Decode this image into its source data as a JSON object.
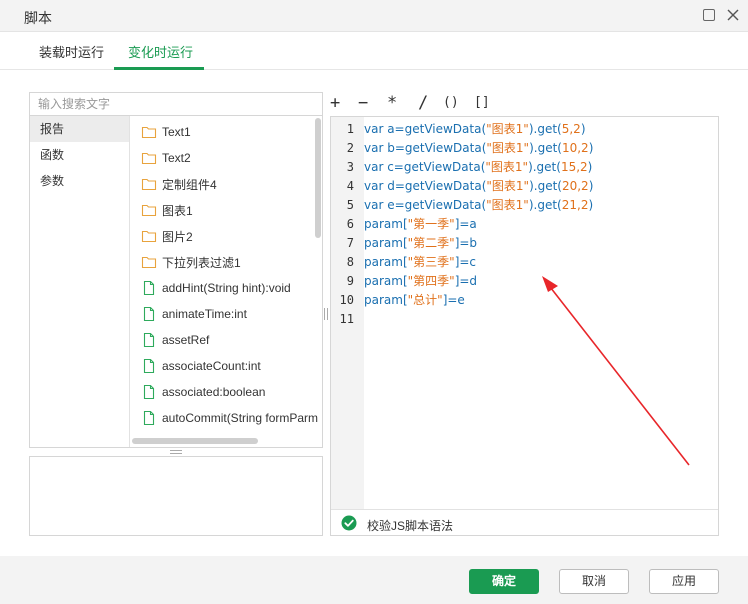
{
  "window": {
    "title": "脚本"
  },
  "tabs": [
    {
      "label": "装载时运行",
      "active": false
    },
    {
      "label": "变化时运行",
      "active": true
    }
  ],
  "search": {
    "placeholder": "输入搜索文字"
  },
  "categories": [
    {
      "label": "报告",
      "selected": true
    },
    {
      "label": "函数",
      "selected": false
    },
    {
      "label": "参数",
      "selected": false
    }
  ],
  "items": [
    {
      "label": "Text1",
      "icon": "folder-icon"
    },
    {
      "label": "Text2",
      "icon": "folder-icon"
    },
    {
      "label": "定制组件4",
      "icon": "folder-icon"
    },
    {
      "label": "图表1",
      "icon": "folder-icon"
    },
    {
      "label": "图片2",
      "icon": "folder-icon"
    },
    {
      "label": "下拉列表过滤1",
      "icon": "folder-icon"
    },
    {
      "label": "addHint(String hint):void",
      "icon": "file-icon"
    },
    {
      "label": "animateTime:int",
      "icon": "file-icon"
    },
    {
      "label": "assetRef",
      "icon": "file-icon"
    },
    {
      "label": "associateCount:int",
      "icon": "file-icon"
    },
    {
      "label": "associated:boolean",
      "icon": "file-icon"
    },
    {
      "label": "autoCommit(String formParm",
      "icon": "file-icon"
    }
  ],
  "operators": [
    "+",
    "−",
    "*",
    "/",
    "()",
    "[]"
  ],
  "code": {
    "line_numbers": [
      "1",
      "2",
      "3",
      "4",
      "5",
      "6",
      "7",
      "8",
      "9",
      "10",
      "11"
    ],
    "lines": [
      {
        "pre": "var a=getViewData(",
        "str": "\"图表1\"",
        "mid": ").get(",
        "num": "5,2",
        "post": ")"
      },
      {
        "pre": "var b=getViewData(",
        "str": "\"图表1\"",
        "mid": ").get(",
        "num": "10,2",
        "post": ")"
      },
      {
        "pre": "var c=getViewData(",
        "str": "\"图表1\"",
        "mid": ").get(",
        "num": "15,2",
        "post": ")"
      },
      {
        "pre": "var d=getViewData(",
        "str": "\"图表1\"",
        "mid": ").get(",
        "num": "20,2",
        "post": ")"
      },
      {
        "pre": "var e=getViewData(",
        "str": "\"图表1\"",
        "mid": ").get(",
        "num": "21,2",
        "post": ")"
      },
      {
        "pre": "param[",
        "str": "\"第一季\"",
        "mid": "]=a",
        "num": "",
        "post": ""
      },
      {
        "pre": "param[",
        "str": "\"第二季\"",
        "mid": "]=b",
        "num": "",
        "post": ""
      },
      {
        "pre": "param[",
        "str": "\"第三季\"",
        "mid": "]=c",
        "num": "",
        "post": ""
      },
      {
        "pre": "param[",
        "str": "\"第四季\"",
        "mid": "]=d",
        "num": "",
        "post": ""
      },
      {
        "pre": "param[",
        "str": "\"总计\"",
        "mid": "]=e",
        "num": "",
        "post": ""
      },
      {
        "pre": "",
        "str": "",
        "mid": "",
        "num": "",
        "post": ""
      }
    ]
  },
  "validate": {
    "label": "校验JS脚本语法",
    "icon": "check-circle-icon"
  },
  "buttons": {
    "ok": "确定",
    "cancel": "取消",
    "apply": "应用"
  },
  "colors": {
    "accent": "#1a9b52",
    "code_keyword": "#1a6fb0",
    "code_string": "#e0711b",
    "annotation_arrow": "#e8262a"
  }
}
